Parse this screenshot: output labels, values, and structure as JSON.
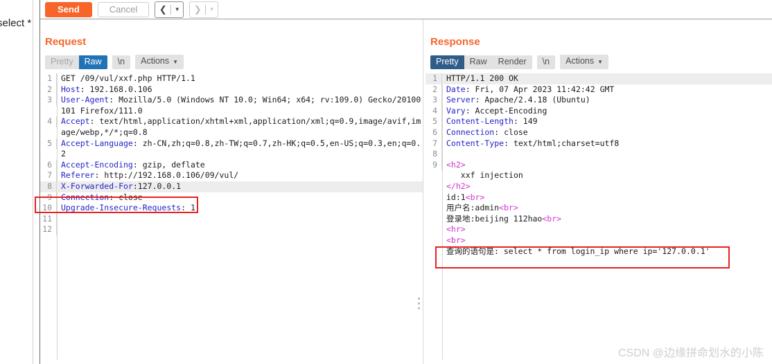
{
  "left_strip": {
    "label": "select *"
  },
  "toolbar": {
    "send_label": "Send",
    "cancel_label": "Cancel",
    "prev_icon": "chevron-left-icon",
    "next_icon": "chevron-right-icon",
    "caret_icon": "▾"
  },
  "layout_toggle": {
    "side_by_side_label": "side-by-side-layout",
    "stacked_label": "stacked-layout",
    "active": "side-by-side"
  },
  "request": {
    "title": "Request",
    "tabs": [
      "Pretty",
      "Raw",
      "\\n"
    ],
    "active_tab": "Raw",
    "actions_label": "Actions",
    "lines": [
      {
        "n": "1",
        "segments": [
          {
            "t": "GET /09/vul/xxf.php HTTP/1.1",
            "c": "plain"
          }
        ]
      },
      {
        "n": "2",
        "segments": [
          {
            "t": "Host",
            "c": "hdr"
          },
          {
            "t": ": 192.168.0.106",
            "c": "plain"
          }
        ]
      },
      {
        "n": "3",
        "segments": [
          {
            "t": "User-Agent",
            "c": "hdr"
          },
          {
            "t": ": Mozilla/5.0 (Windows NT 10.0; Win64; x64; rv:109.0) Gecko/20100101 Firefox/111.0",
            "c": "plain"
          }
        ]
      },
      {
        "n": "4",
        "segments": [
          {
            "t": "Accept",
            "c": "hdr"
          },
          {
            "t": ": text/html,application/xhtml+xml,application/xml;q=0.9,image/avif,image/webp,*/*;q=0.8",
            "c": "plain"
          }
        ]
      },
      {
        "n": "5",
        "segments": [
          {
            "t": "Accept-Language",
            "c": "hdr"
          },
          {
            "t": ": zh-CN,zh;q=0.8,zh-TW;q=0.7,zh-HK;q=0.5,en-US;q=0.3,en;q=0.2",
            "c": "plain"
          }
        ]
      },
      {
        "n": "6",
        "segments": [
          {
            "t": "Accept-Encoding",
            "c": "hdr"
          },
          {
            "t": ": gzip, deflate",
            "c": "plain"
          }
        ]
      },
      {
        "n": "7",
        "segments": [
          {
            "t": "Referer",
            "c": "hdr"
          },
          {
            "t": ": http://192.168.0.106/09/vul/",
            "c": "plain"
          }
        ]
      },
      {
        "n": "8",
        "highlight": true,
        "segments": [
          {
            "t": "X-Forwarded-For",
            "c": "hdr"
          },
          {
            "t": ":127.0.0.1",
            "c": "plain"
          }
        ]
      },
      {
        "n": "9",
        "segments": [
          {
            "t": "Connection",
            "c": "hdr"
          },
          {
            "t": ": close",
            "c": "plain"
          }
        ]
      },
      {
        "n": "10",
        "segments": [
          {
            "t": "Upgrade-Insecure-Requests",
            "c": "hdr"
          },
          {
            "t": ": 1",
            "c": "plain"
          }
        ]
      },
      {
        "n": "11",
        "segments": []
      },
      {
        "n": "12",
        "segments": []
      }
    ]
  },
  "response": {
    "title": "Response",
    "tabs": [
      "Pretty",
      "Raw",
      "Render",
      "\\n"
    ],
    "active_tab": "Pretty",
    "actions_label": "Actions",
    "lines": [
      {
        "n": "1",
        "highlight": true,
        "segments": [
          {
            "t": "HTTP/1.1 200 OK",
            "c": "plain"
          }
        ]
      },
      {
        "n": "2",
        "segments": [
          {
            "t": "Date",
            "c": "hdr"
          },
          {
            "t": ": Fri, 07 Apr 2023 11:42:42 GMT",
            "c": "plain"
          }
        ]
      },
      {
        "n": "3",
        "segments": [
          {
            "t": "Server",
            "c": "hdr"
          },
          {
            "t": ": Apache/2.4.18 (Ubuntu)",
            "c": "plain"
          }
        ]
      },
      {
        "n": "4",
        "segments": [
          {
            "t": "Vary",
            "c": "hdr"
          },
          {
            "t": ": Accept-Encoding",
            "c": "plain"
          }
        ]
      },
      {
        "n": "5",
        "segments": [
          {
            "t": "Content-Length",
            "c": "hdr"
          },
          {
            "t": ": 149",
            "c": "plain"
          }
        ]
      },
      {
        "n": "6",
        "segments": [
          {
            "t": "Connection",
            "c": "hdr"
          },
          {
            "t": ": close",
            "c": "plain"
          }
        ]
      },
      {
        "n": "7",
        "segments": [
          {
            "t": "Content-Type",
            "c": "hdr"
          },
          {
            "t": ": text/html;charset=utf8",
            "c": "plain"
          }
        ]
      },
      {
        "n": "8",
        "segments": []
      },
      {
        "n": "9",
        "segments": [
          {
            "t": "<h2>",
            "c": "tag"
          }
        ]
      },
      {
        "n": "",
        "segments": [
          {
            "t": "   xxf injection",
            "c": "plain"
          }
        ]
      },
      {
        "n": "",
        "segments": [
          {
            "t": "</h2>",
            "c": "tag"
          }
        ]
      },
      {
        "n": "",
        "segments": [
          {
            "t": "id:1",
            "c": "plain"
          },
          {
            "t": "<br>",
            "c": "tag"
          }
        ]
      },
      {
        "n": "",
        "segments": [
          {
            "t": "用户名:admin",
            "c": "plain"
          },
          {
            "t": "<br>",
            "c": "tag"
          }
        ]
      },
      {
        "n": "",
        "segments": [
          {
            "t": "登录地:beijing 112hao",
            "c": "plain"
          },
          {
            "t": "<br>",
            "c": "tag"
          }
        ]
      },
      {
        "n": "",
        "segments": [
          {
            "t": "<hr>",
            "c": "tag"
          }
        ]
      },
      {
        "n": "",
        "segments": [
          {
            "t": "<br>",
            "c": "tag"
          }
        ]
      },
      {
        "n": "",
        "segments": [
          {
            "t": "查询的语句是: select * from login_ip where ip='127.0.0.1'",
            "c": "plain"
          }
        ]
      }
    ]
  },
  "annotations": {
    "request_highlight": "X-Forwarded-For:127.0.0.1",
    "response_highlight": "查询的语句是: select * from login_ip where ip='127.0.0.1'"
  },
  "watermark": {
    "text": "CSDN @边缘拼命划水的小陈"
  },
  "colors": {
    "accent_orange": "#f7652b",
    "tab_active_blue": "#2f5d8a",
    "header_key_blue": "#2323c8",
    "tag_magenta": "#cc33cc",
    "annotation_red": "#e8201f"
  }
}
